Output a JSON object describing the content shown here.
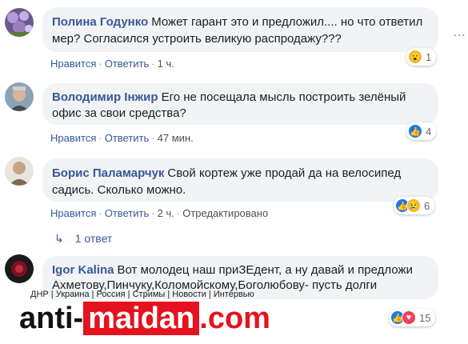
{
  "comments": [
    {
      "author": "Полина Годунко",
      "text": "Может гарант это и предложил.... но что ответил мер? Согласился устроить великую распродажу???",
      "like": "Нравится",
      "reply": "Ответить",
      "time": "1 ч.",
      "reactions": [
        "wow"
      ],
      "reaction_count": "1"
    },
    {
      "author": "Володимир Інжир",
      "text": "Его не посещала мысль построить зелёный офис за свои средства?",
      "like": "Нравится",
      "reply": "Ответить",
      "time": "47 мин.",
      "reactions": [
        "like"
      ],
      "reaction_count": "4"
    },
    {
      "author": "Борис Паламарчук",
      "text": "Свой кортеж уже продай да на велосипед садись. Сколько можно.",
      "like": "Нравится",
      "reply": "Ответить",
      "time": "2 ч.",
      "edited": "Отредактировано",
      "reactions": [
        "like",
        "sad"
      ],
      "reaction_count": "6",
      "replies": "1 ответ"
    },
    {
      "author": "Igor Kalina",
      "text": "Вот молодец наш приЗЕдент, а ну давай и предложи Ахметову,Пинчуку,Коломойскому,Боголюбову- пусть долги",
      "reactions": [
        "like",
        "love"
      ],
      "reaction_count": "15"
    }
  ],
  "site_nav": "ДНР | Украина | Россия | Стримы | Новости | Интервью",
  "watermark": {
    "part1": "anti-",
    "part2": "maidan",
    "part3": ".com"
  },
  "colors": {
    "link": "#385898",
    "bubble": "#f2f3f5",
    "brand_red": "#e4131f"
  },
  "icons": {
    "more": "more-icon",
    "reply_arrow": "reply-arrow-icon"
  }
}
